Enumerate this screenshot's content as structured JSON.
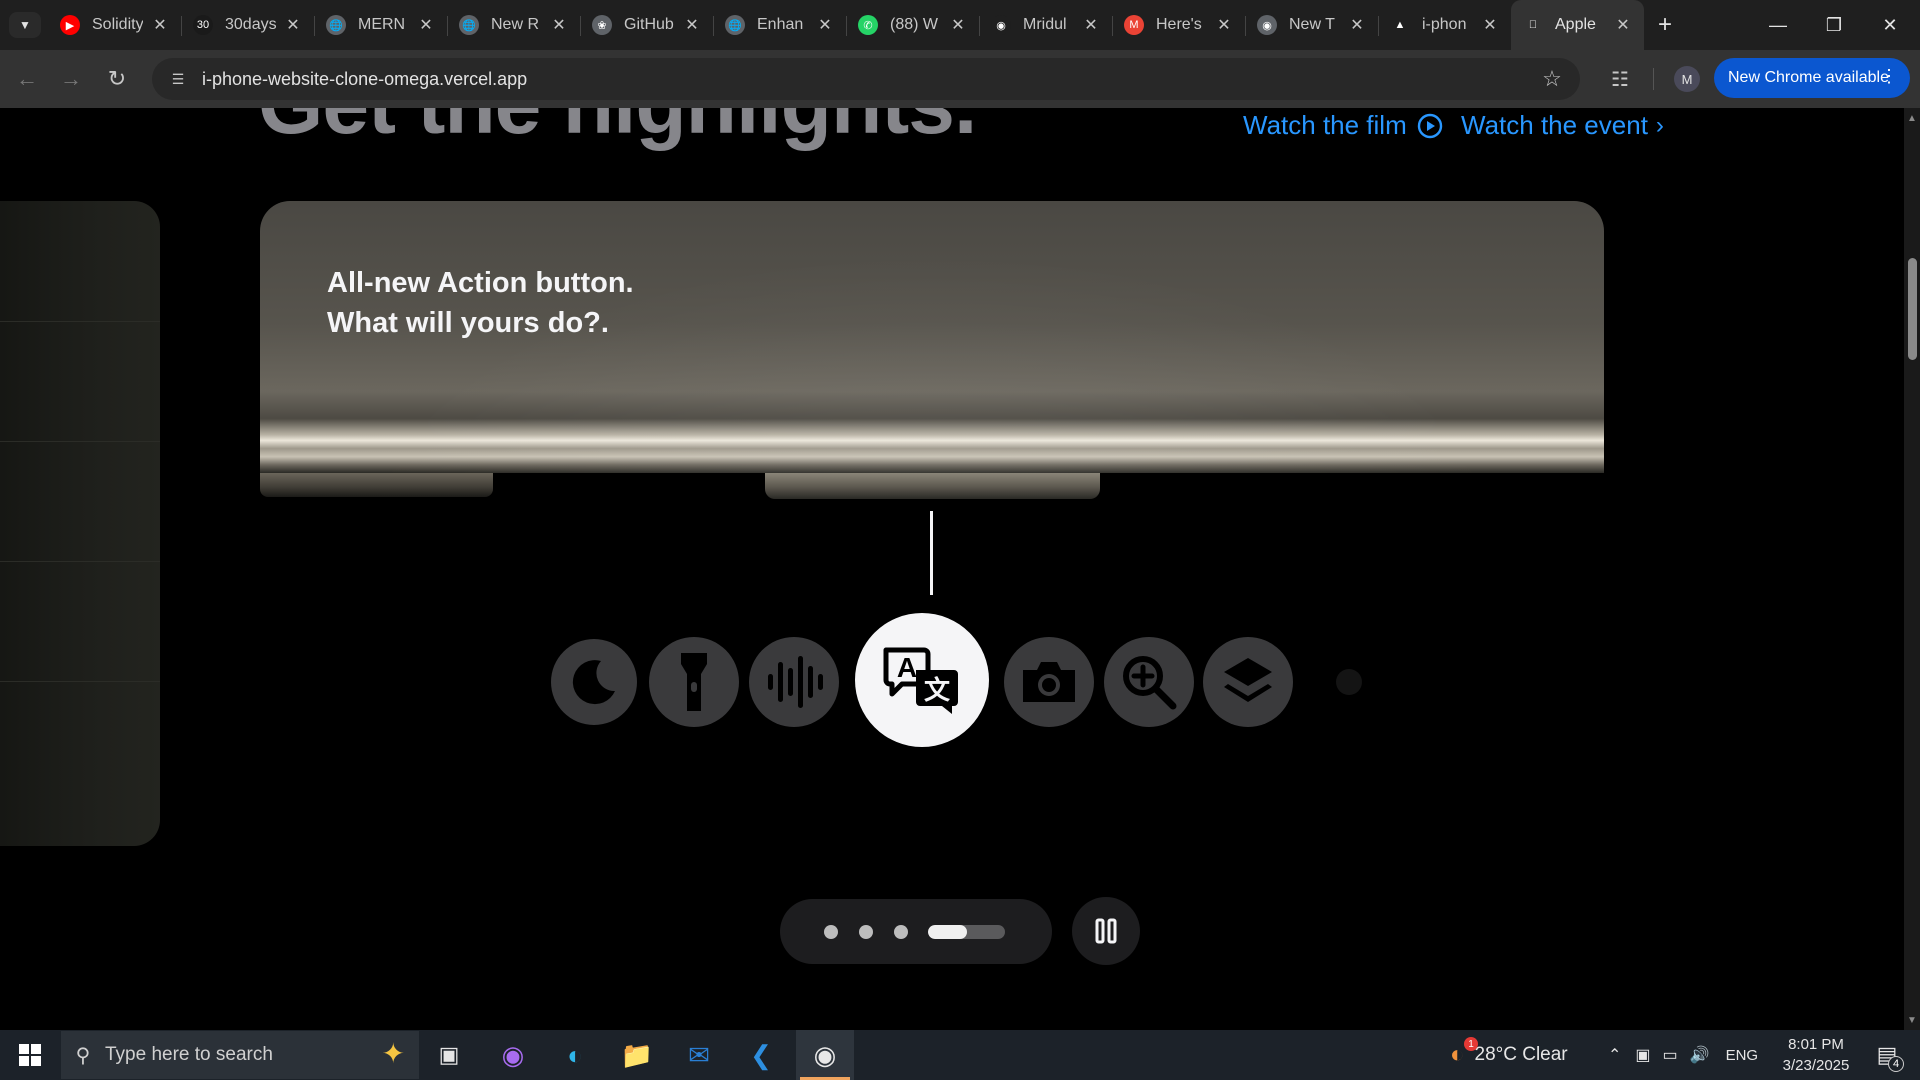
{
  "browser": {
    "tabs": [
      {
        "title": "Solidity",
        "favicon": "youtube-icon",
        "color": "#ff0000"
      },
      {
        "title": "30days",
        "favicon": "30days-icon",
        "color": "#1a1a1a"
      },
      {
        "title": "MERN",
        "favicon": "globe-icon",
        "color": "#5f6368"
      },
      {
        "title": "New R",
        "favicon": "globe-icon",
        "color": "#5f6368"
      },
      {
        "title": "GitHub",
        "favicon": "openai-icon",
        "color": "#5f6368"
      },
      {
        "title": "Enhan",
        "favicon": "globe-icon",
        "color": "#5f6368"
      },
      {
        "title": "(88) W",
        "favicon": "whatsapp-icon",
        "color": "#25d366"
      },
      {
        "title": "Mridul",
        "favicon": "github-icon",
        "color": "#1f1f1f"
      },
      {
        "title": "Here's",
        "favicon": "gmail-icon",
        "color": "#ea4335"
      },
      {
        "title": "New T",
        "favicon": "chrome-icon",
        "color": "#5f6368"
      },
      {
        "title": "i-phon",
        "favicon": "vercel-icon",
        "color": "#000000"
      },
      {
        "title": "Apple",
        "favicon": "apple-icon",
        "color": "#ffffff"
      }
    ],
    "active_tab_index": 11,
    "url": "i-phone-website-clone-omega.vercel.app",
    "profile_initial": "M",
    "update_label": "New Chrome available"
  },
  "page": {
    "headline": "Get the highlights.",
    "watch_film": "Watch the film",
    "watch_event": "Watch the event",
    "caption_line1": "All-new Action button.",
    "caption_line2": "What will yours do?.",
    "action_icons": [
      "moon-icon",
      "flashlight-icon",
      "voice-memo-icon",
      "translate-icon",
      "camera-icon",
      "magnifier-icon",
      "shortcuts-icon",
      "accessibility-icon"
    ],
    "selected_action": "translate-icon",
    "carousel_slides": 4,
    "carousel_active_index": 3,
    "carousel_progress": 0.5,
    "accent_color": "#2997ff"
  },
  "taskbar": {
    "search_placeholder": "Type here to search",
    "weather": "28°C Clear",
    "language": "ENG",
    "time": "8:01 PM",
    "date": "3/23/2025",
    "notification_count": "4",
    "weather_badge": "1"
  }
}
